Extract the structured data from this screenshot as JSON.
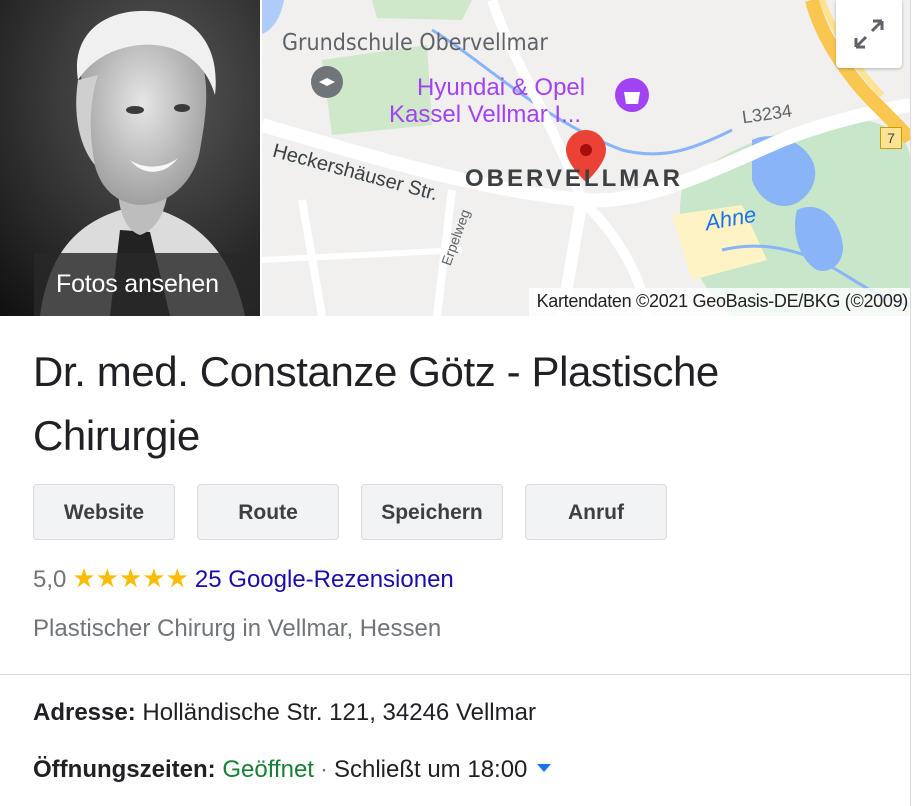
{
  "photo": {
    "label": "Fotos ansehen"
  },
  "map": {
    "labels": {
      "school": "Grundschule Obervellmar",
      "dealer_line1": "Hyundai & Opel",
      "dealer_line2": "Kassel Vellmar I...",
      "district": "OBERVELLMAR",
      "street": "Heckershäuser Str.",
      "small_street": "Erpelweg",
      "road_number": "L3234",
      "route_badge": "7",
      "river": "Ahne"
    },
    "attribution": "Kartendaten ©2021 GeoBasis-DE/BKG (©2009)",
    "colors": {
      "pin": "#ea4335",
      "water": "#8ab4f8",
      "park": "#c8e6c9",
      "highway": "#fdd663"
    }
  },
  "business": {
    "name": "Dr. med. Constanze Götz - Plastische Chirurgie",
    "buttons": [
      "Website",
      "Route",
      "Speichern",
      "Anruf"
    ],
    "rating": "5,0",
    "stars": "★★★★★",
    "star_count": 5,
    "reviews_link": "25 Google-Rezensionen",
    "category": "Plastischer Chirurg in Vellmar, Hessen",
    "address_label": "Adresse:",
    "address": "Holländische Str. 121, 34246 Vellmar",
    "hours_label": "Öffnungszeiten:",
    "hours_status": "Geöffnet",
    "hours_separator": "·",
    "hours_detail": "Schließt um 18:00"
  },
  "colors": {
    "accent": "#1a73e8",
    "link": "#1a0dab",
    "open_status": "#188038",
    "star": "#fbbc04"
  }
}
